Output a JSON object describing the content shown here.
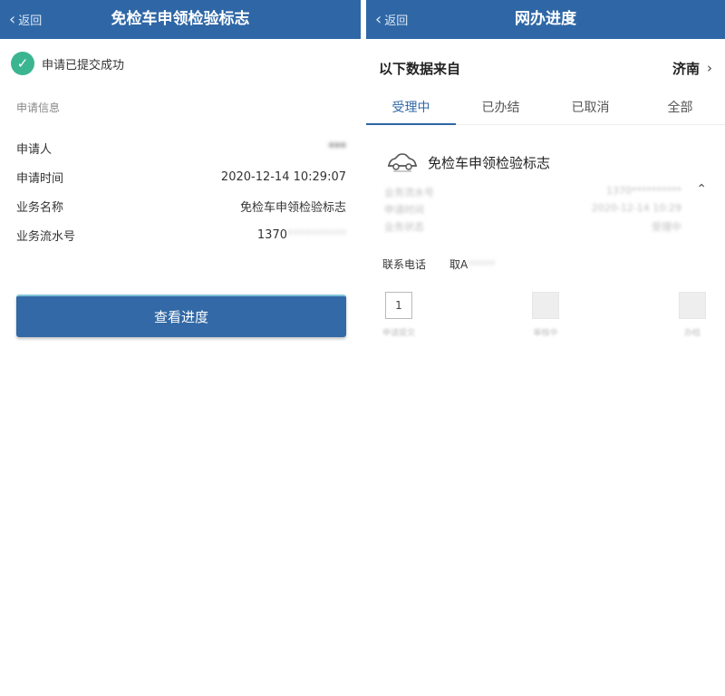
{
  "left": {
    "back_label": "返回",
    "title": "免检车申领检验标志",
    "success_text": "申请已提交成功",
    "section_label": "申请信息",
    "rows": [
      {
        "label": "申请人",
        "value": "***"
      },
      {
        "label": "申请时间",
        "value": "2020-12-14 10:29:07"
      },
      {
        "label": "业务名称",
        "value": "免检车申领检验标志"
      },
      {
        "label": "业务流水号",
        "value_prefix": "1370",
        "value_rest": "**********"
      }
    ],
    "button_label": "查看进度"
  },
  "right": {
    "back_label": "返回",
    "title": "网办进度",
    "source_label": "以下数据来自",
    "city": "济南",
    "tabs": [
      {
        "label": "受理中",
        "active": true
      },
      {
        "label": "已办结",
        "active": false
      },
      {
        "label": "已取消",
        "active": false
      },
      {
        "label": "全部",
        "active": false
      }
    ],
    "card_title": "免检车申领检验标志",
    "details": [
      {
        "label": "业务流水号",
        "value": "1370**********"
      },
      {
        "label": "申请时间",
        "value": "2020-12-14 10:29"
      },
      {
        "label": "业务状态",
        "value": "受理中"
      }
    ],
    "contact_label": "联系电话",
    "contact_value_prefix": "取A",
    "contact_value_rest": "*****",
    "steps": [
      {
        "label": "1",
        "caption": "申请提交"
      },
      {
        "label": "",
        "caption": "审核中"
      },
      {
        "label": "",
        "caption": "办结"
      }
    ]
  },
  "colors": {
    "header_blue": "#2f67a6",
    "success_green": "#3bb58f",
    "button_blue": "#3269a6"
  },
  "icons": {
    "back": "chevron-left-icon",
    "success": "check-circle-icon",
    "city_arrow": "chevron-right-icon",
    "car": "car-icon",
    "expand": "chevron-up-icon"
  }
}
